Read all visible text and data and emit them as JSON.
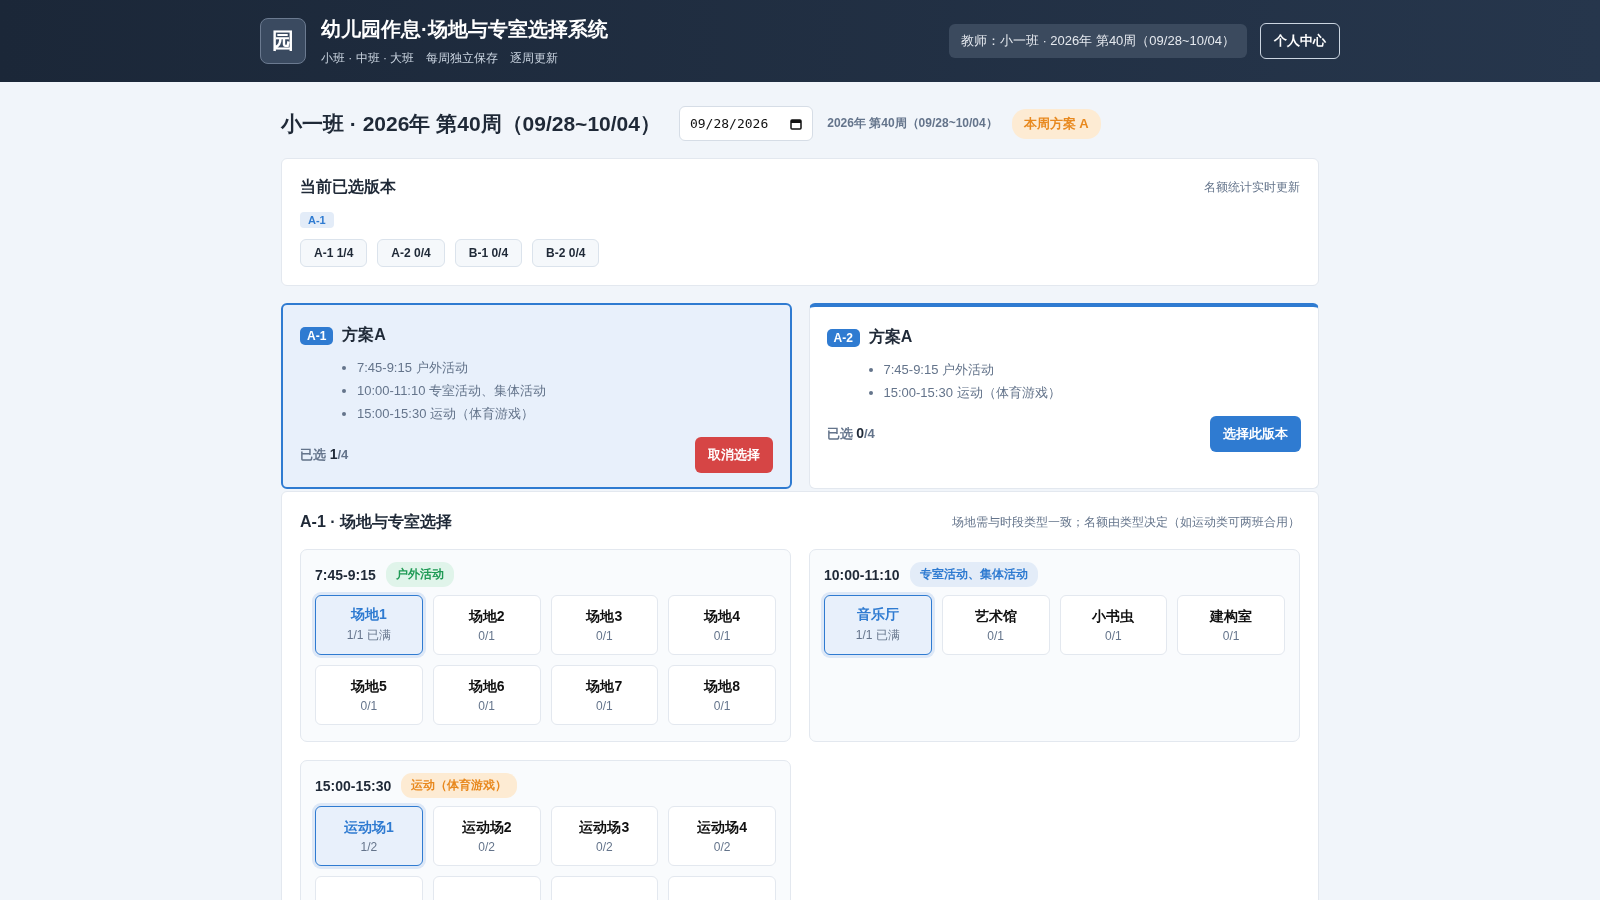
{
  "header": {
    "logo": "园",
    "title": "幼儿园作息·场地与专室选择系统",
    "subtitle": [
      "小班 · 中班 · 大班",
      "每周独立保存",
      "逐周更新"
    ],
    "teacher": "教师：小一班 · 2026年 第40周（09/28~10/04）",
    "profile_button": "个人中心"
  },
  "week": {
    "title": "小一班 · 2026年 第40周（09/28~10/04）",
    "date_value": "09/28/2026",
    "week_label": "2026年 第40周（09/28~10/04）",
    "plan_badge": "本周方案 A"
  },
  "current": {
    "title": "当前已选版本",
    "note": "名额统计实时更新",
    "selected_tag": "A-1",
    "versions": [
      {
        "label": "A-1 1/4"
      },
      {
        "label": "A-2 0/4"
      },
      {
        "label": "B-1 0/4"
      },
      {
        "label": "B-2 0/4"
      }
    ]
  },
  "plans": [
    {
      "code": "A-1",
      "name": "方案A",
      "selected": true,
      "items": [
        "7:45-9:15 户外活动",
        "10:00-11:10 专室活动、集体活动",
        "15:00-15:30 运动（体育游戏）"
      ],
      "count_label": "已选",
      "count": "1",
      "total": "/4",
      "button": "取消选择"
    },
    {
      "code": "A-2",
      "name": "方案A",
      "selected": false,
      "items": [
        "7:45-9:15 户外活动",
        "15:00-15:30 运动（体育游戏）"
      ],
      "count_label": "已选",
      "count": "0",
      "total": "/4",
      "button": "选择此版本"
    }
  ],
  "venues": {
    "title": "A-1 · 场地与专室选择",
    "note": "场地需与时段类型一致；名额由类型决定（如运动类可两班合用）",
    "slots": [
      {
        "time": "7:45-9:15",
        "tag": "户外活动",
        "kind": "outdoor",
        "options": [
          {
            "name": "场地1",
            "quota": "1/1 已满",
            "selected": true
          },
          {
            "name": "场地2",
            "quota": "0/1",
            "selected": false
          },
          {
            "name": "场地3",
            "quota": "0/1",
            "selected": false
          },
          {
            "name": "场地4",
            "quota": "0/1",
            "selected": false
          },
          {
            "name": "场地5",
            "quota": "0/1",
            "selected": false
          },
          {
            "name": "场地6",
            "quota": "0/1",
            "selected": false
          },
          {
            "name": "场地7",
            "quota": "0/1",
            "selected": false
          },
          {
            "name": "场地8",
            "quota": "0/1",
            "selected": false
          }
        ]
      },
      {
        "time": "10:00-11:10",
        "tag": "专室活动、集体活动",
        "kind": "room",
        "options": [
          {
            "name": "音乐厅",
            "quota": "1/1 已满",
            "selected": true
          },
          {
            "name": "艺术馆",
            "quota": "0/1",
            "selected": false
          },
          {
            "name": "小书虫",
            "quota": "0/1",
            "selected": false
          },
          {
            "name": "建构室",
            "quota": "0/1",
            "selected": false
          }
        ]
      },
      {
        "time": "15:00-15:30",
        "tag": "运动（体育游戏）",
        "kind": "sport",
        "options": [
          {
            "name": "运动场1",
            "quota": "1/2",
            "selected": true
          },
          {
            "name": "运动场2",
            "quota": "0/2",
            "selected": false
          },
          {
            "name": "运动场3",
            "quota": "0/2",
            "selected": false
          },
          {
            "name": "运动场4",
            "quota": "0/2",
            "selected": false
          },
          {
            "selected": false
          },
          {
            "selected": false
          },
          {
            "selected": false
          },
          {
            "selected": false
          }
        ]
      }
    ]
  }
}
